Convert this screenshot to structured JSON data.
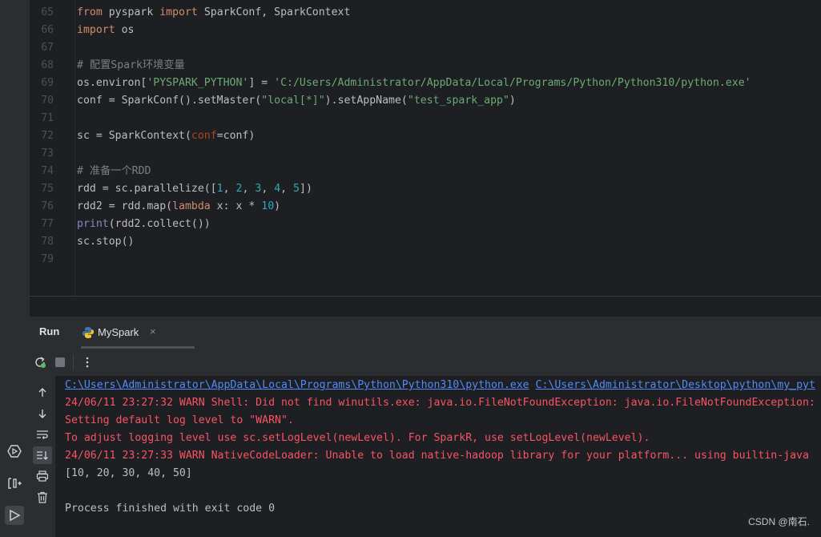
{
  "editor": {
    "line_numbers": [
      "65",
      "66",
      "67",
      "68",
      "69",
      "70",
      "71",
      "72",
      "73",
      "74",
      "75",
      "76",
      "77",
      "78",
      "79"
    ],
    "lines": [
      [
        {
          "t": "from",
          "c": "kw"
        },
        {
          "t": " pyspark ",
          "c": ""
        },
        {
          "t": "import",
          "c": "kw"
        },
        {
          "t": " SparkConf, SparkContext",
          "c": ""
        }
      ],
      [
        {
          "t": "import",
          "c": "kw"
        },
        {
          "t": " os",
          "c": ""
        }
      ],
      [],
      [
        {
          "t": "# 配置Spark环境变量",
          "c": "cmt"
        }
      ],
      [
        {
          "t": "os.environ[",
          "c": ""
        },
        {
          "t": "'PYSPARK_PYTHON'",
          "c": "str"
        },
        {
          "t": "] = ",
          "c": ""
        },
        {
          "t": "'C:/Users/Administrator/AppData/Local/Programs/Python/Python310/python.exe'",
          "c": "str"
        }
      ],
      [
        {
          "t": "conf = SparkConf().setMaster(",
          "c": ""
        },
        {
          "t": "\"local[*]\"",
          "c": "str"
        },
        {
          "t": ").setAppName(",
          "c": ""
        },
        {
          "t": "\"test_spark_app\"",
          "c": "str"
        },
        {
          "t": ")",
          "c": ""
        }
      ],
      [],
      [
        {
          "t": "sc = SparkContext(",
          "c": ""
        },
        {
          "t": "conf",
          "c": "param"
        },
        {
          "t": "=conf)",
          "c": ""
        }
      ],
      [],
      [
        {
          "t": "# 准备一个RDD",
          "c": "cmt"
        }
      ],
      [
        {
          "t": "rdd = sc.parallelize([",
          "c": ""
        },
        {
          "t": "1",
          "c": "num"
        },
        {
          "t": ", ",
          "c": ""
        },
        {
          "t": "2",
          "c": "num"
        },
        {
          "t": ", ",
          "c": ""
        },
        {
          "t": "3",
          "c": "num"
        },
        {
          "t": ", ",
          "c": ""
        },
        {
          "t": "4",
          "c": "num"
        },
        {
          "t": ", ",
          "c": ""
        },
        {
          "t": "5",
          "c": "num"
        },
        {
          "t": "])",
          "c": ""
        }
      ],
      [
        {
          "t": "rdd2 = rdd.map(",
          "c": ""
        },
        {
          "t": "lambda",
          "c": "kw"
        },
        {
          "t": " x: x * ",
          "c": ""
        },
        {
          "t": "10",
          "c": "num"
        },
        {
          "t": ")",
          "c": ""
        }
      ],
      [
        {
          "t": "print",
          "c": "builtin"
        },
        {
          "t": "(rdd2.collect())",
          "c": ""
        }
      ],
      [
        {
          "t": "sc.stop()",
          "c": ""
        }
      ],
      []
    ]
  },
  "tool_window": {
    "title": "Run",
    "tab_label": "MySpark",
    "tab_close": "×"
  },
  "console": {
    "lines": [
      [
        {
          "t": "C:\\Users\\Administrator\\AppData\\Local\\Programs\\Python\\Python310\\python.exe",
          "c": "out-link"
        },
        {
          "t": " ",
          "c": "out-plain"
        },
        {
          "t": "C:\\Users\\Administrator\\Desktop\\python\\my_pyt",
          "c": "out-link"
        }
      ],
      [
        {
          "t": "24/06/11 23:27:32 WARN Shell: Did not find winutils.exe: java.io.FileNotFoundException: java.io.FileNotFoundException:",
          "c": "out-err"
        }
      ],
      [
        {
          "t": "Setting default log level to \"WARN\".",
          "c": "out-err"
        }
      ],
      [
        {
          "t": "To adjust logging level use sc.setLogLevel(newLevel). For SparkR, use setLogLevel(newLevel).",
          "c": "out-err"
        }
      ],
      [
        {
          "t": "24/06/11 23:27:33 WARN NativeCodeLoader: Unable to load native-hadoop library for your platform... using builtin-java",
          "c": "out-err"
        }
      ],
      [
        {
          "t": "[10, 20, 30, 40, 50]",
          "c": "out-plain"
        }
      ],
      [],
      [
        {
          "t": "Process finished with exit code 0",
          "c": "out-plain"
        }
      ]
    ]
  },
  "watermark": "CSDN @南石.",
  "icons": {
    "left_strip": [
      "services-icon",
      "terminal-icon",
      "run-icon"
    ],
    "toolbar": [
      "rerun-icon",
      "stop-icon",
      "more-icon"
    ],
    "console_side": [
      "scroll-up-icon",
      "scroll-down-icon",
      "soft-wrap-icon",
      "scroll-to-end-icon",
      "print-icon",
      "clear-icon"
    ],
    "tab": "python-icon"
  }
}
